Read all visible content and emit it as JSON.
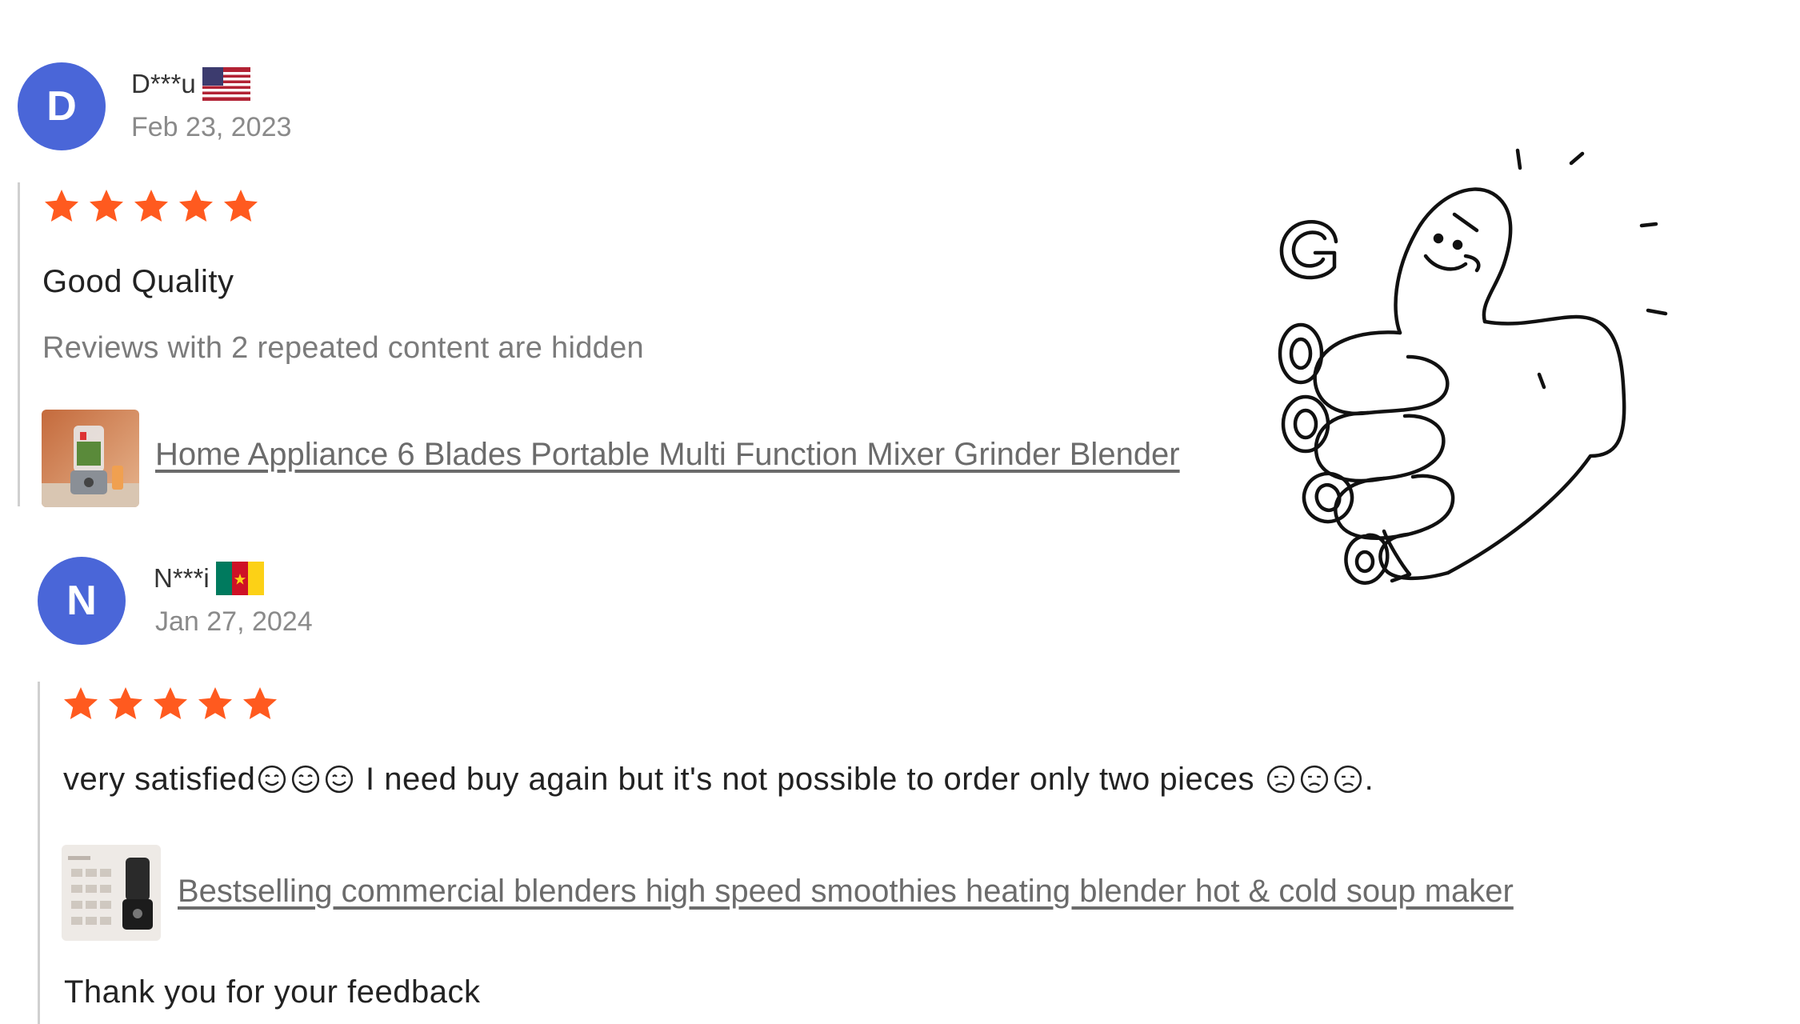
{
  "reviews": [
    {
      "avatar_letter": "D",
      "user": "D***u",
      "country_flag": "us-flag-icon",
      "date": "Feb 23, 2023",
      "rating": 5,
      "title": "Good Quality",
      "hidden_note": "Reviews with 2 repeated content are hidden",
      "product": "Home Appliance 6 Blades Portable Multi Function Mixer Grinder Blender"
    },
    {
      "avatar_letter": "N",
      "user": "N***i",
      "country_flag": "cameroon-flag-icon",
      "date": "Jan 27, 2024",
      "rating": 5,
      "text_a": "very satisfied",
      "text_b": " I need buy again but it's not possible to order only two pieces ",
      "text_c": ".",
      "product": "Bestselling commercial blenders high speed smoothies heating blender hot & cold soup maker",
      "seller_reply": "Thank you for your feedback"
    }
  ],
  "colors": {
    "avatar": "#4a66d8",
    "star": "#ff5a1f",
    "link": "#6b6b6b",
    "muted": "#8a8a8a"
  }
}
